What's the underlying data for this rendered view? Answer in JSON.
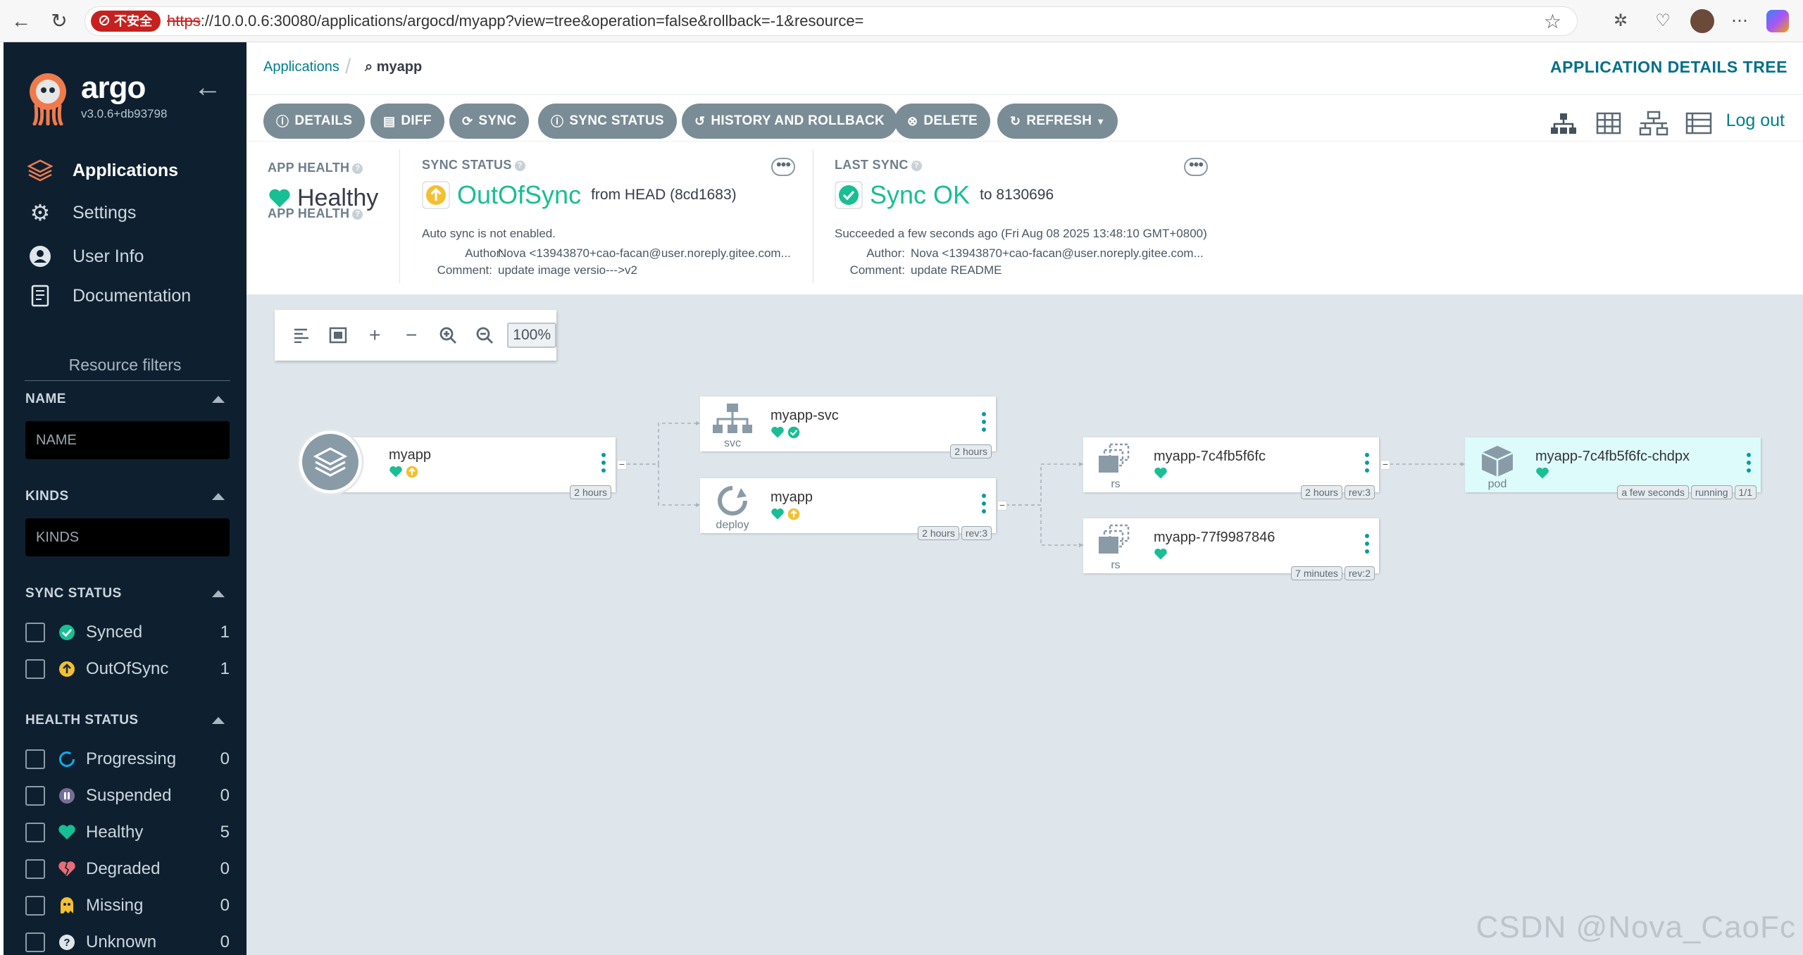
{
  "browser": {
    "insecure_label": "不安全",
    "url_scheme": "https",
    "url_rest": "://10.0.0.6:30080/applications/argocd/myapp?view=tree&operation=false&rollback=-1&resource="
  },
  "sidebar": {
    "brand": "argo",
    "version": "v3.0.6+db93798",
    "nav": [
      {
        "label": "Applications",
        "icon": "layers-icon"
      },
      {
        "label": "Settings",
        "icon": "gears-icon"
      },
      {
        "label": "User Info",
        "icon": "user-icon"
      },
      {
        "label": "Documentation",
        "icon": "docs-icon"
      }
    ],
    "resource_filters_title": "Resource filters",
    "name_header": "NAME",
    "name_placeholder": "NAME",
    "kinds_header": "KINDS",
    "kinds_placeholder": "KINDS",
    "sync_status_header": "SYNC STATUS",
    "sync_status": [
      {
        "label": "Synced",
        "count": "1"
      },
      {
        "label": "OutOfSync",
        "count": "1"
      }
    ],
    "health_status_header": "HEALTH STATUS",
    "health_status": [
      {
        "label": "Progressing",
        "count": "0"
      },
      {
        "label": "Suspended",
        "count": "0"
      },
      {
        "label": "Healthy",
        "count": "5"
      },
      {
        "label": "Degraded",
        "count": "0"
      },
      {
        "label": "Missing",
        "count": "0"
      },
      {
        "label": "Unknown",
        "count": "0"
      }
    ]
  },
  "header": {
    "breadcrumb_root": "Applications",
    "breadcrumb_current": "myapp",
    "page_title": "APPLICATION DETAILS TREE",
    "logout": "Log out"
  },
  "toolbar": {
    "details": "DETAILS",
    "diff": "DIFF",
    "sync": "SYNC",
    "sync_status": "SYNC STATUS",
    "history": "HISTORY AND ROLLBACK",
    "delete": "DELETE",
    "refresh": "REFRESH"
  },
  "status": {
    "app_health_label": "APP HEALTH",
    "app_health_value": "Healthy",
    "sync_status_label": "SYNC STATUS",
    "sync_status_value": "OutOfSync",
    "sync_status_from": "from HEAD (8cd1683)",
    "auto_sync": "Auto sync is not enabled.",
    "author_label": "Author:",
    "author_value": "Nova <13943870+cao-facan@user.noreply.gitee.com...",
    "comment_label": "Comment:",
    "sync_comment": "update image versio--->v2",
    "last_sync_label": "LAST SYNC",
    "last_sync_value": "Sync OK",
    "last_sync_to": "to 8130696",
    "last_sync_detail": "Succeeded a few seconds ago (Fri Aug 08 2025 13:48:10 GMT+0800)",
    "last_author_value": "Nova <13943870+cao-facan@user.noreply.gitee.com...",
    "last_comment": "update README"
  },
  "graph": {
    "zoom": "100%",
    "nodes": {
      "app": {
        "name": "myapp",
        "age": "2 hours"
      },
      "svc": {
        "name": "myapp-svc",
        "kind": "svc",
        "age": "2 hours"
      },
      "deploy": {
        "name": "myapp",
        "kind": "deploy",
        "age": "2 hours",
        "rev": "rev:3"
      },
      "rs1": {
        "name": "myapp-7c4fb5f6fc",
        "kind": "rs",
        "age": "2 hours",
        "rev": "rev:3"
      },
      "rs2": {
        "name": "myapp-77f9987846",
        "kind": "rs",
        "age": "7 minutes",
        "rev": "rev:2"
      },
      "pod": {
        "name": "myapp-7c4fb5f6fc-chdpx",
        "kind": "pod",
        "age": "a few seconds",
        "state": "running",
        "ready": "1/1"
      }
    }
  },
  "watermark": "CSDN @Nova_CaoFc",
  "colors": {
    "sidebar_bg": "#0e2030",
    "healthy": "#18be94",
    "out_of_sync": "#f4c030",
    "accent": "#00808a",
    "button": "#7a8c96"
  }
}
